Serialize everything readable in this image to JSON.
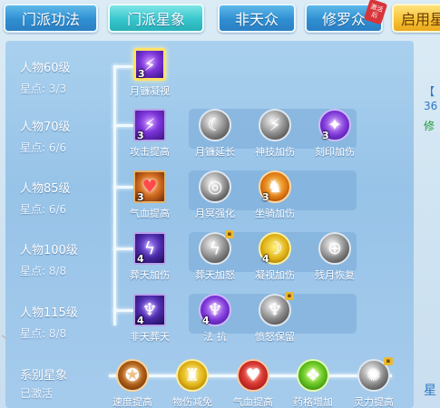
{
  "tabs": [
    {
      "label": "门派功法",
      "state": "normal"
    },
    {
      "label": "门派星象",
      "state": "active"
    },
    {
      "label": "非天众",
      "state": "normal"
    },
    {
      "label": "修罗众",
      "state": "normal",
      "badge": "激活后"
    },
    {
      "label": "启用星",
      "state": "gold"
    }
  ],
  "rows": [
    {
      "level": "人物60级",
      "stars": "星点: 3/3",
      "skills": [
        {
          "name": "月镰凝视",
          "count": "3",
          "icon": "claw-icon",
          "selected": true
        }
      ]
    },
    {
      "level": "人物70级",
      "stars": "星点: 6/6",
      "skills": [
        {
          "name": "攻击提高",
          "count": "3",
          "icon": "claw-icon"
        },
        {
          "name": "月镰延长",
          "icon": "sickle-icon"
        },
        {
          "name": "神技加伤",
          "icon": "claw-gray-icon"
        },
        {
          "name": "刻印加伤",
          "count": "3",
          "icon": "rune-icon"
        }
      ]
    },
    {
      "level": "人物85级",
      "stars": "星点: 6/6",
      "skills": [
        {
          "name": "气血提高",
          "count": "3",
          "icon": "heart-icon"
        },
        {
          "name": "月冥强化",
          "icon": "moon-ring-icon"
        },
        {
          "name": "坐骑加伤",
          "count": "3",
          "icon": "mount-icon"
        }
      ]
    },
    {
      "level": "人物100级",
      "stars": "星点: 8/8",
      "skills": [
        {
          "name": "葬天加伤",
          "count": "4",
          "icon": "lightning-icon"
        },
        {
          "name": "葬天加怒",
          "icon": "lightning-gray-icon"
        },
        {
          "name": "凝视加伤",
          "count": "4",
          "icon": "crescent-icon"
        },
        {
          "name": "残月恢复",
          "icon": "crosshair-icon"
        }
      ]
    },
    {
      "level": "人物115级",
      "stars": "星点: 8/8",
      "skills": [
        {
          "name": "非天葬天",
          "count": "4",
          "icon": "demon-icon"
        },
        {
          "name": "法 抗",
          "count": "4",
          "icon": "demon-purple-icon"
        },
        {
          "name": "愤怒保留",
          "icon": "demon-gray-icon"
        }
      ]
    }
  ],
  "system": {
    "label": "系别星象",
    "status": "已激活",
    "skills": [
      {
        "name": "速度提高",
        "icon": "speed-icon"
      },
      {
        "name": "物伤减免",
        "icon": "armor-icon"
      },
      {
        "name": "气血提高",
        "icon": "heart-icon"
      },
      {
        "name": "药格增加",
        "icon": "potion-icon"
      },
      {
        "name": "灵力提高",
        "icon": "spirit-icon"
      }
    ]
  },
  "side": {
    "bracket": "【",
    "number": "36",
    "green": "修",
    "bottom": "星"
  },
  "colors": {
    "active_tab": "#37c6cc",
    "tab_blue": "#2f8fd1",
    "gold_tab": "#f6c234",
    "side_green": "#1f9a3a",
    "side_blue": "#2b78c4"
  }
}
